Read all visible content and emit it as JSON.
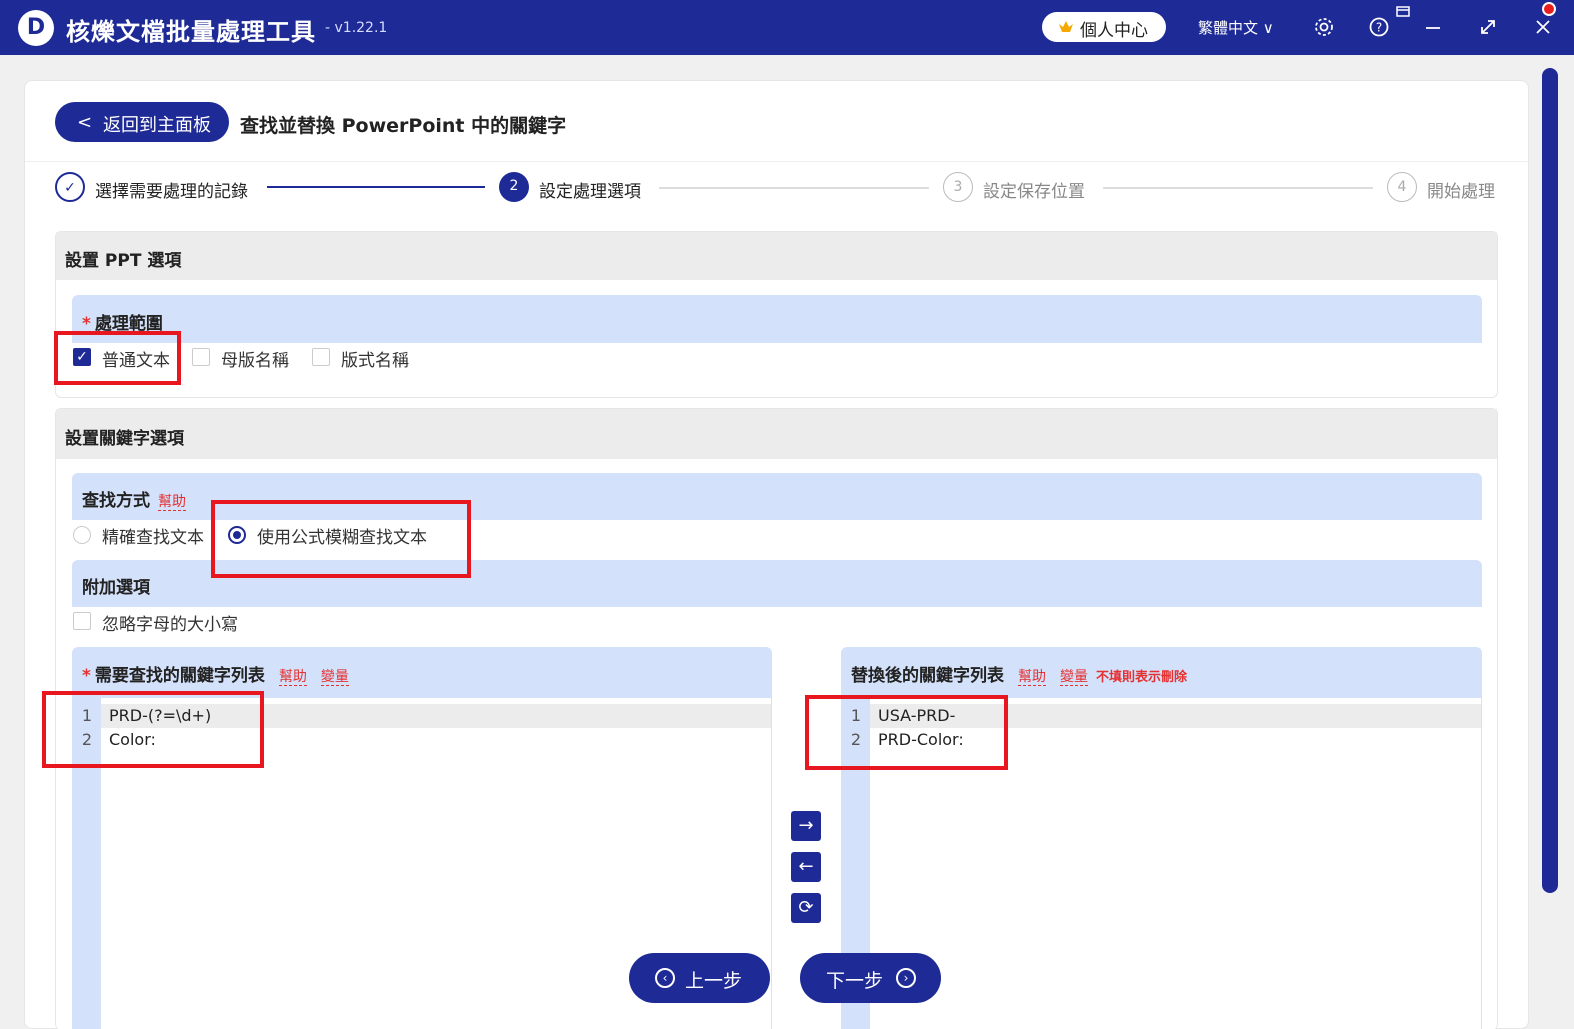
{
  "app": {
    "logo_letter": "D",
    "title": "核爍文檔批量處理工具",
    "version": "- v1.22.1",
    "user_center": "個人中心",
    "language": "繁體中文"
  },
  "header": {
    "back_label": "返回到主面板",
    "page_title": "查找並替換 PowerPoint 中的關鍵字"
  },
  "steps": [
    {
      "num": "✓",
      "label": "選擇需要處理的記錄",
      "state": "done"
    },
    {
      "num": "2",
      "label": "設定處理選項",
      "state": "active"
    },
    {
      "num": "3",
      "label": "設定保存位置",
      "state": "todo"
    },
    {
      "num": "4",
      "label": "開始處理",
      "state": "todo"
    }
  ],
  "ppt_section": {
    "title": "設置 PPT 選項",
    "scope_label": "處理範圍",
    "options": [
      {
        "label": "普通文本",
        "checked": true
      },
      {
        "label": "母版名稱",
        "checked": false
      },
      {
        "label": "版式名稱",
        "checked": false
      }
    ]
  },
  "keyword_section": {
    "title": "設置關鍵字選項",
    "find_mode_label": "查找方式",
    "help": "幫助",
    "find_modes": [
      {
        "label": "精確查找文本",
        "selected": false
      },
      {
        "label": "使用公式模糊查找文本",
        "selected": true
      }
    ],
    "extra_label": "附加選項",
    "ignore_case": "忽略字母的大小寫",
    "find_list_label": "需要查找的關鍵字列表",
    "replace_list_label": "替換後的關鍵字列表",
    "variable": "變量",
    "empty_means_delete": "不填則表示刪除",
    "find_lines": [
      "PRD-(?=\\d+)",
      "Color:"
    ],
    "replace_lines": [
      "USA-PRD-",
      "PRD-Color:"
    ]
  },
  "footer": {
    "prev_label": "上一步",
    "next_label": "下一步"
  },
  "colors": {
    "primary": "#1e2a96",
    "highlight_red": "#e8161e",
    "subhead_blue": "#d4e1fa"
  }
}
